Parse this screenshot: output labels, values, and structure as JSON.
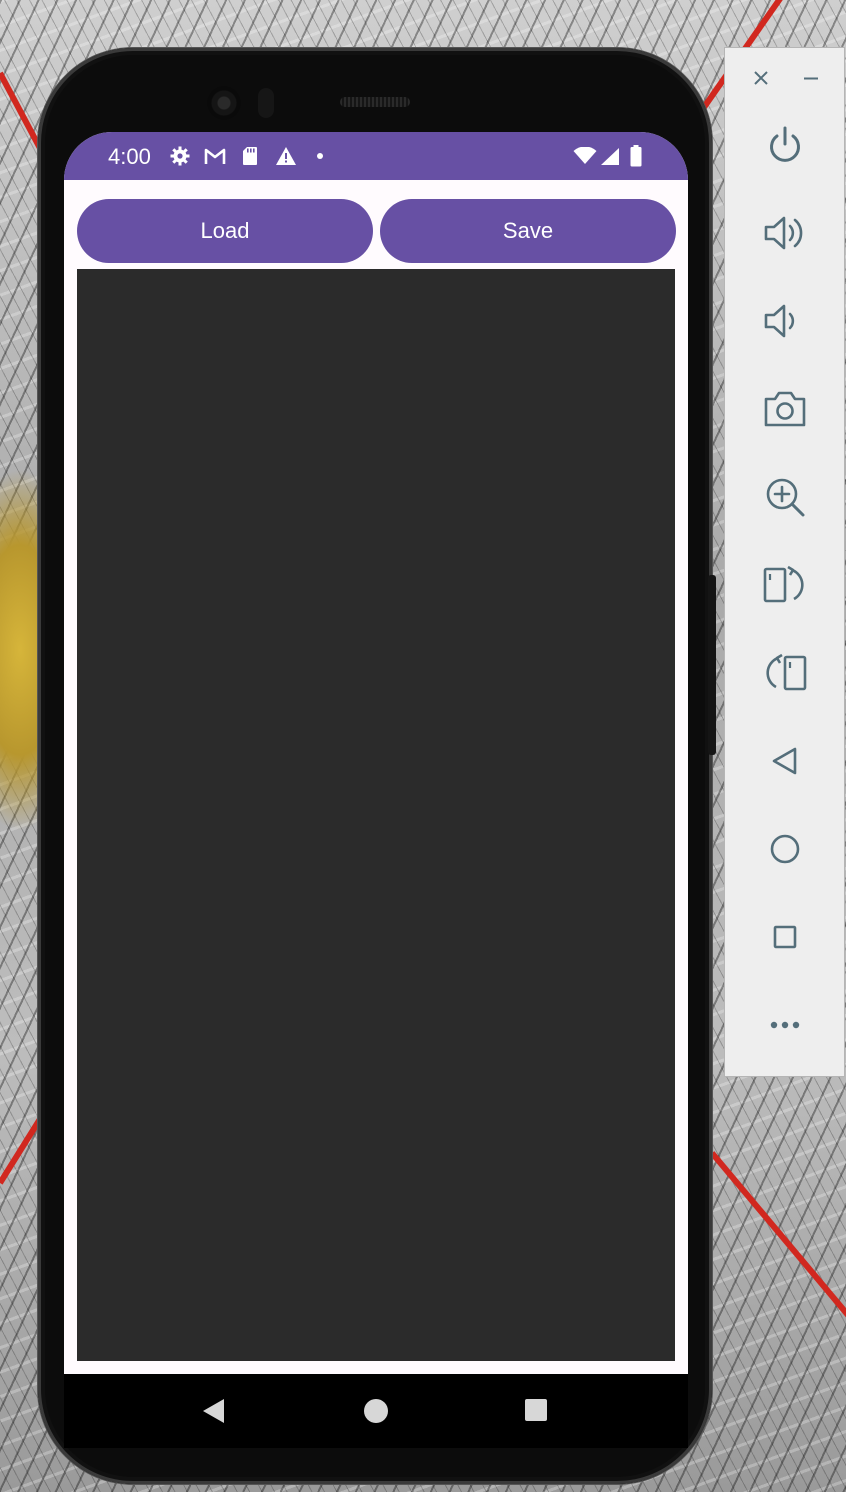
{
  "status_bar": {
    "time": "4:00",
    "left_icons": [
      "gear-icon",
      "gmail-icon",
      "sd-card-icon",
      "warning-icon",
      "dot-icon"
    ],
    "right_icons": [
      "wifi-icon",
      "cell-signal-icon",
      "battery-icon"
    ],
    "color": "#6750a4"
  },
  "app": {
    "load_label": "Load",
    "save_label": "Save",
    "accent": "#6750a4",
    "canvas_color": "#2b2b2b"
  },
  "nav": {
    "items": [
      "back-icon",
      "home-icon",
      "recents-icon"
    ]
  },
  "emulator_toolbar": {
    "items": [
      "close-icon",
      "minimize-icon",
      "power-icon",
      "volume-up-icon",
      "volume-down-icon",
      "camera-icon",
      "zoom-icon",
      "rotate-left-icon",
      "rotate-right-icon",
      "back-icon",
      "home-icon",
      "overview-icon",
      "more-icon"
    ]
  }
}
